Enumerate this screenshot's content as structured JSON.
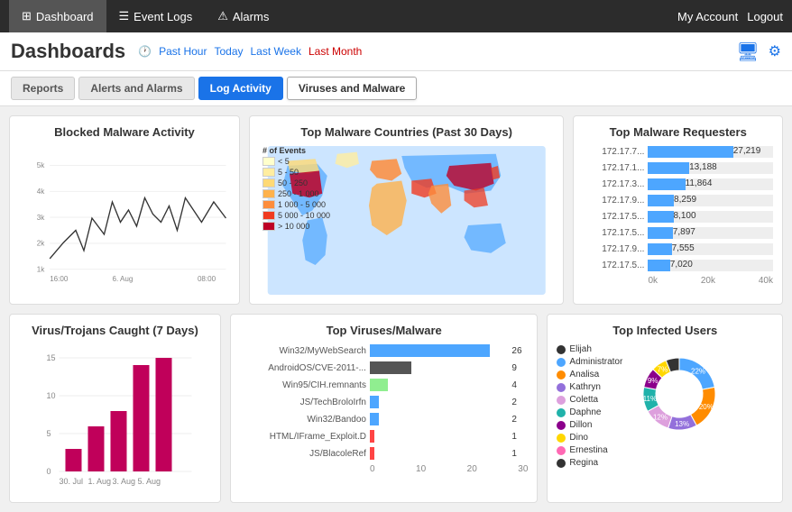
{
  "topNav": {
    "items": [
      {
        "label": "Dashboard",
        "icon": "⊞",
        "active": true
      },
      {
        "label": "Event Logs",
        "icon": "☰",
        "active": false
      },
      {
        "label": "Alarms",
        "icon": "⚠",
        "active": false
      }
    ],
    "right": [
      "My Account",
      "Logout"
    ]
  },
  "header": {
    "title": "Dashboards",
    "timeLinks": [
      "Past Hour",
      "Today",
      "Last Week",
      "Last Month"
    ],
    "activeTime": "Last Month"
  },
  "tabs": [
    {
      "label": "Reports",
      "style": "default"
    },
    {
      "label": "Alerts and Alarms",
      "style": "default"
    },
    {
      "label": "Log Activity",
      "style": "primary"
    },
    {
      "label": "Viruses and Malware",
      "style": "selected"
    }
  ],
  "blockedMalware": {
    "title": "Blocked Malware Activity",
    "yLabels": [
      "5k",
      "4k",
      "3k",
      "2k",
      "1k"
    ],
    "xLabels": [
      "16:00",
      "6. Aug",
      "08:00"
    ]
  },
  "topMalwareCountries": {
    "title": "Top Malware Countries (Past 30 Days)",
    "legendTitle": "# of Events",
    "legendItems": [
      {
        "color": "#ffffcc",
        "label": "< 5"
      },
      {
        "color": "#ffeda0",
        "label": "5 - 50"
      },
      {
        "color": "#fed976",
        "label": "50 - 250"
      },
      {
        "color": "#feb24c",
        "label": "250 - 1 000"
      },
      {
        "color": "#fd8d3c",
        "label": "1 000 - 5 000"
      },
      {
        "color": "#f03b20",
        "label": "5 000 - 10 000"
      },
      {
        "color": "#bd0026",
        "label": "> 10 000"
      }
    ]
  },
  "topMalwareRequesters": {
    "title": "Top Malware Requesters",
    "rows": [
      {
        "label": "172.17.7...",
        "value": 27219,
        "maxVal": 40000
      },
      {
        "label": "172.17.1...",
        "value": 13188,
        "maxVal": 40000
      },
      {
        "label": "172.17.3...",
        "value": 11864,
        "maxVal": 40000
      },
      {
        "label": "172.17.9...",
        "value": 8259,
        "maxVal": 40000
      },
      {
        "label": "172.17.5...",
        "value": 8100,
        "maxVal": 40000
      },
      {
        "label": "172.17.5...",
        "value": 7897,
        "maxVal": 40000
      },
      {
        "label": "172.17.9...",
        "value": 7555,
        "maxVal": 40000
      },
      {
        "label": "172.17.5...",
        "value": 7020,
        "maxVal": 40000
      }
    ],
    "axisLabels": [
      "0k",
      "20k",
      "40k"
    ]
  },
  "virusTrojans": {
    "title": "Virus/Trojans Caught (7 Days)",
    "bars": [
      {
        "label": "30. Jul",
        "value": 3
      },
      {
        "label": "1. Aug",
        "value": 6
      },
      {
        "label": "3. Aug",
        "value": 8
      },
      {
        "label": "5. Aug",
        "value": 14
      },
      {
        "label": "",
        "value": 15
      }
    ],
    "yMax": 15,
    "yLabels": [
      "15",
      "10",
      "5",
      "0"
    ]
  },
  "topViruses": {
    "title": "Top Viruses/Malware",
    "rows": [
      {
        "label": "Win32/MyWebSearch",
        "value": 26,
        "color": "#4da6ff"
      },
      {
        "label": "AndroidOS/CVE-2011-...",
        "value": 9,
        "color": "#555"
      },
      {
        "label": "Win95/CIH.remnants",
        "value": 4,
        "color": "#90ee90"
      },
      {
        "label": "JS/TechBroloIrfn",
        "value": 2,
        "color": "#4da6ff"
      },
      {
        "label": "Win32/Bandoo",
        "value": 2,
        "color": "#4da6ff"
      },
      {
        "label": "HTML/IFrame_Exploit.D",
        "value": 1,
        "color": "#ff4444"
      },
      {
        "label": "JS/BlacoleRef",
        "value": 1,
        "color": "#ff4444"
      }
    ],
    "maxVal": 30,
    "axisLabels": [
      "0",
      "10",
      "20",
      "30"
    ]
  },
  "topInfectedUsers": {
    "title": "Top Infected Users",
    "users": [
      {
        "label": "Elijah",
        "color": "#333"
      },
      {
        "label": "Administrator",
        "color": "#4da6ff"
      },
      {
        "label": "Analisa",
        "color": "#ff8c00"
      },
      {
        "label": "Kathryn",
        "color": "#9370db"
      },
      {
        "label": "Coletta",
        "color": "#dda0dd"
      },
      {
        "label": "Daphne",
        "color": "#20b2aa"
      },
      {
        "label": "Dillon",
        "color": "#8b008b"
      },
      {
        "label": "Dino",
        "color": "#ffd700"
      },
      {
        "label": "Ernestina",
        "color": "#ff69b4"
      },
      {
        "label": "Regina",
        "color": "#333"
      }
    ],
    "donutSegments": [
      {
        "pct": 22,
        "color": "#4da6ff"
      },
      {
        "pct": 20,
        "color": "#ff8c00"
      },
      {
        "pct": 13,
        "color": "#9370db"
      },
      {
        "pct": 12,
        "color": "#dda0dd"
      },
      {
        "pct": 11,
        "color": "#20b2aa"
      },
      {
        "pct": 9,
        "color": "#8b008b"
      },
      {
        "pct": 7,
        "color": "#ffd700"
      },
      {
        "pct": 6,
        "color": "#333"
      }
    ]
  }
}
